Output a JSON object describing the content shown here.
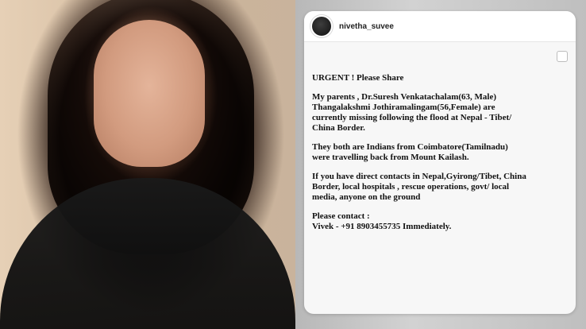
{
  "post": {
    "username": "nivetha_suvee",
    "text": {
      "p1": "URGENT ! Please Share",
      "p2_lines": [
        "My parents , Dr.Suresh Venkatachalam(63, Male)",
        "Thangalakshmi Jothiramalingam(56,Female) are",
        "currently missing following the flood at Nepal - Tibet/",
        "China Border."
      ],
      "p3_lines": [
        "They both are Indians from Coimbatore(Tamilnadu)",
        "were travelling back from Mount Kailash."
      ],
      "p4_lines": [
        "If you have direct contacts in Nepal,Gyirong/Tibet, China",
        "Border, local hospitals , rescue operations, govt/ local",
        "media, anyone on the ground"
      ],
      "p5_lines": [
        "Please contact :",
        "Vivek - +91 8903455735 Immediately."
      ]
    }
  }
}
